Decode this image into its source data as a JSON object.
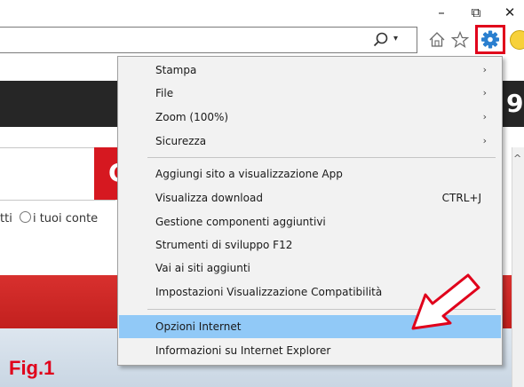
{
  "window": {
    "minimize_glyph": "–",
    "restore_glyph": "⧉",
    "close_glyph": "✕"
  },
  "toolbar": {
    "search_icon": "magnifier-icon",
    "dropdown_glyph": "▾",
    "home_icon": "home-icon",
    "favorites_icon": "star-icon",
    "tools_icon": "gear-icon",
    "feedback_icon": "smiley-icon"
  },
  "page": {
    "dark_band_letter": "9",
    "search_button_letter": "C",
    "radio_label": "tti",
    "radio_option": "i tuoi conte",
    "figure_label": "Fig.1",
    "scroll_arrow_glyph": "^"
  },
  "menu": {
    "items": [
      {
        "label": "Stampa",
        "submenu": true
      },
      {
        "label": "File",
        "submenu": true
      },
      {
        "label": "Zoom (100%)",
        "submenu": true
      },
      {
        "label": "Sicurezza",
        "submenu": true
      },
      {
        "label": "Aggiungi sito a visualizzazione App"
      },
      {
        "label": "Visualizza download",
        "shortcut": "CTRL+J"
      },
      {
        "label": "Gestione componenti aggiuntivi"
      },
      {
        "label": "Strumenti di sviluppo F12"
      },
      {
        "label": "Vai ai siti aggiunti"
      },
      {
        "label": "Impostazioni Visualizzazione Compatibilità"
      },
      {
        "label": "Opzioni Internet",
        "highlighted": true
      },
      {
        "label": "Informazioni su Internet Explorer"
      }
    ],
    "submenu_glyph": "›"
  },
  "colors": {
    "highlight": "#91c9f7",
    "annotation_red": "#e0001b",
    "gear_blue": "#2a7fcf"
  }
}
